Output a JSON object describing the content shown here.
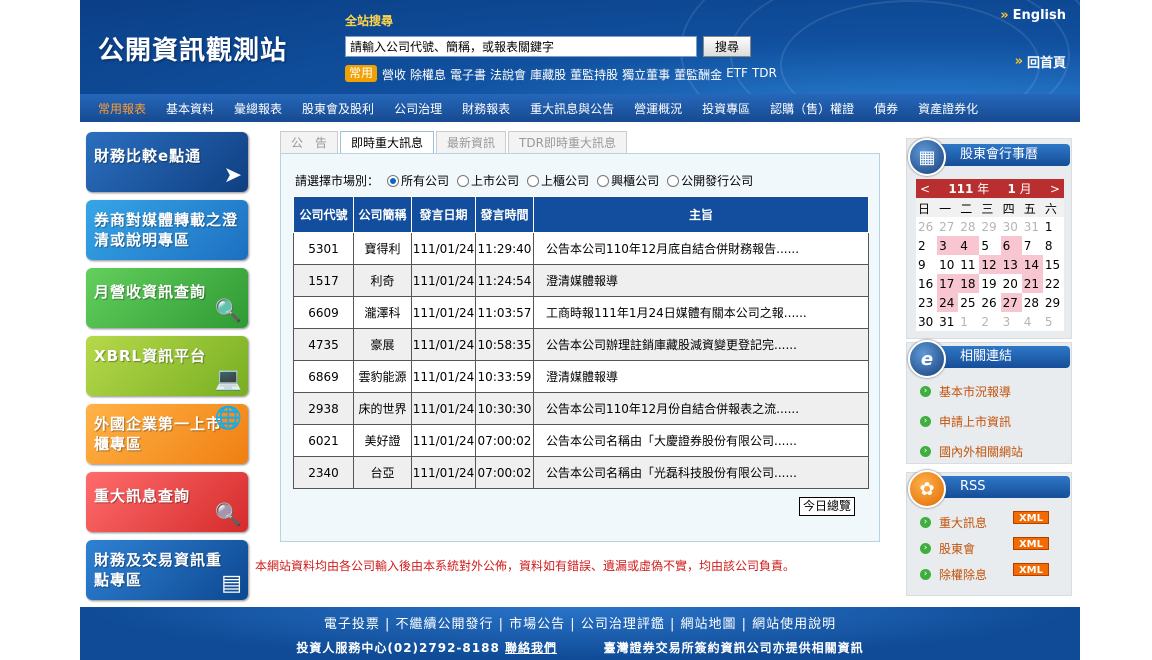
{
  "header": {
    "site_title": "公開資訊觀測站",
    "search_title": "全站搜尋",
    "search_placeholder": "請輸入公司代號、簡稱，或報表關鍵字",
    "search_button": "搜尋",
    "english_link": "English",
    "home_link": "回首頁",
    "quick_tag": "常用",
    "quick_links": [
      "營收",
      "除權息",
      "電子書",
      "法說會",
      "庫藏股",
      "董監持股",
      "獨立董事",
      "董監酬金",
      "ETF",
      "TDR"
    ]
  },
  "nav": {
    "items": [
      "常用報表",
      "基本資料",
      "彙總報表",
      "股東會及股利",
      "公司治理",
      "財務報表",
      "重大訊息與公告",
      "營運概況",
      "投資專區",
      "認購（售）權證",
      "債券",
      "資產證券化"
    ],
    "active": "常用報表"
  },
  "left_banners": [
    {
      "text": "財務比較e點通",
      "icon": "pointer-icon"
    },
    {
      "text": "券商對媒體轉載之澄清或說明專區",
      "icon": "none"
    },
    {
      "text": "月營收資訊查詢",
      "icon": "magnifier-chart-icon"
    },
    {
      "text": "XBRL資訊平台",
      "icon": "person-computer-icon"
    },
    {
      "text": "外國企業第一上市櫃專區",
      "icon": "globe-icon"
    },
    {
      "text": "重大訊息查詢",
      "icon": "magnifier-chart-icon"
    },
    {
      "text": "財務及交易資訊重點專區",
      "icon": "bar-chart-icon"
    }
  ],
  "tabs": [
    "公　告",
    "即時重大訊息",
    "最新資訊",
    "TDR即時重大訊息"
  ],
  "active_tab": "即時重大訊息",
  "market_filter": {
    "label": "請選擇市場別：",
    "options": [
      "所有公司",
      "上市公司",
      "上櫃公司",
      "興櫃公司",
      "公開發行公司"
    ],
    "selected": "所有公司"
  },
  "news_table": {
    "headers": [
      "公司代號",
      "公司簡稱",
      "發言日期",
      "發言時間",
      "主旨"
    ],
    "rows": [
      [
        "5301",
        "寶得利",
        "111/01/24",
        "11:29:40",
        "公告本公司110年12月底自結合併財務報告......"
      ],
      [
        "1517",
        "利奇",
        "111/01/24",
        "11:24:54",
        "澄清媒體報導"
      ],
      [
        "6609",
        "瀧澤科",
        "111/01/24",
        "11:03:57",
        "工商時報111年1月24日媒體有關本公司之報......"
      ],
      [
        "4735",
        "豪展",
        "111/01/24",
        "10:58:35",
        "公告本公司辦理註銷庫藏股減資變更登記完......"
      ],
      [
        "6869",
        "雲豹能源",
        "111/01/24",
        "10:33:59",
        "澄清媒體報導"
      ],
      [
        "2938",
        "床的世界",
        "111/01/24",
        "10:30:30",
        "公告本公司110年12月份自結合併報表之流......"
      ],
      [
        "6021",
        "美好證",
        "111/01/24",
        "07:00:02",
        "公告本公司名稱由「大慶證券股份有限公司......"
      ],
      [
        "2340",
        "台亞",
        "111/01/24",
        "07:00:02",
        "公告本公司名稱由「光磊科技股份有限公司......"
      ]
    ],
    "today_button": "今日總覽"
  },
  "disclaimer": "本網站資料均由各公司輸入後由本系統對外公佈，資料如有錯誤、遺漏或虛偽不實，均由該公司負責。",
  "shareholder_calendar": {
    "title": "股東會行事曆",
    "prev": "<",
    "year": "111",
    "year_unit": "年",
    "month": "1",
    "month_unit": "月",
    "next": ">",
    "weekdays": [
      "日",
      "一",
      "二",
      "三",
      "四",
      "五",
      "六"
    ],
    "weeks": [
      [
        "26",
        "27",
        "28",
        "29",
        "30",
        "31",
        "1"
      ],
      [
        "2",
        "3",
        "4",
        "5",
        "6",
        "7",
        "8"
      ],
      [
        "9",
        "10",
        "11",
        "12",
        "13",
        "14",
        "15"
      ],
      [
        "16",
        "17",
        "18",
        "19",
        "20",
        "21",
        "22"
      ],
      [
        "23",
        "24",
        "25",
        "26",
        "27",
        "28",
        "29"
      ],
      [
        "30",
        "31",
        "1",
        "2",
        "3",
        "4",
        "5"
      ]
    ],
    "other_month_cells": [
      "0-0",
      "0-1",
      "0-2",
      "0-3",
      "0-4",
      "0-5",
      "5-2",
      "5-3",
      "5-4",
      "5-5",
      "5-6"
    ],
    "highlighted_cells": [
      "1-1",
      "1-2",
      "1-4",
      "2-3",
      "2-4",
      "2-5",
      "3-1",
      "3-2",
      "3-5",
      "4-1",
      "4-4"
    ]
  },
  "related_links": {
    "title": "相關連結",
    "items": [
      "基本市況報導",
      "申請上市資訊",
      "國內外相關網站"
    ]
  },
  "rss": {
    "title": "RSS",
    "items": [
      "重大訊息",
      "股東會",
      "除權除息"
    ],
    "badge": "XML"
  },
  "footer": {
    "links": [
      "電子投票",
      "不繼續公開發行",
      "市場公告",
      "公司治理評鑑",
      "網站地圖",
      "網站使用說明"
    ],
    "service_center": "投資人服務中心(02)2792-8188",
    "contact_link": "聯絡我們",
    "notice": "臺灣證券交易所簽約資訊公司亦提供相關資訊"
  },
  "colors": {
    "header_blue": "#0b3f86",
    "nav_active": "#ff9d2e",
    "table_header": "#124e9d",
    "calendar_highlight": "#f8c6d1",
    "disclaimer_red": "#d01c1c",
    "rss_badge": "#f26a00"
  }
}
